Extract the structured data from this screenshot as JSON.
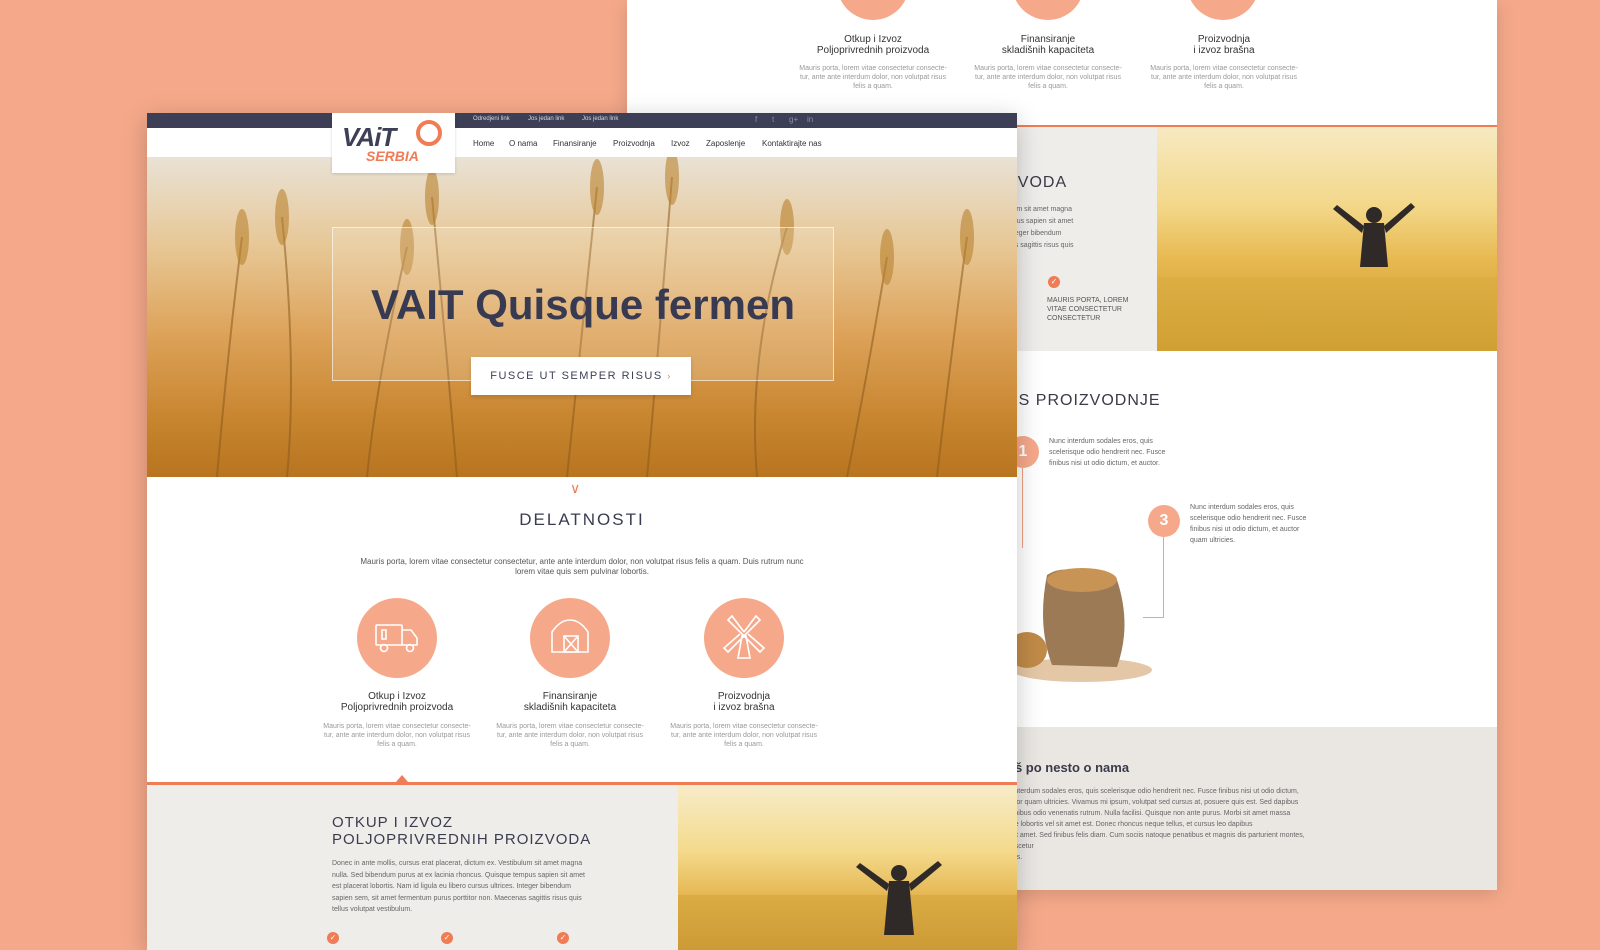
{
  "colors": {
    "background": "#f5a98a",
    "accent": "#ef7c54",
    "navy": "#3d3f56",
    "circle": "#f6a88b"
  },
  "back": {
    "services": [
      {
        "title1": "Otkup i Izvoz",
        "title2": "Poljoprivrednih proizvoda",
        "desc1": "Mauris porta, lorem vitae consectetur consecte-",
        "desc2": "tur, ante ante interdum dolor, non volutpat risus",
        "desc3": "felis a quam."
      },
      {
        "title1": "Finansiranje",
        "title2": "skladišnih kapaciteta",
        "desc1": "Mauris porta, lorem vitae consectetur consecte-",
        "desc2": "tur, ante ante interdum dolor, non volutpat risus",
        "desc3": "felis a quam."
      },
      {
        "title1": "Proizvodnja",
        "title2": "i izvoz brašna",
        "desc1": "Mauris porta, lorem vitae consectetur consecte-",
        "desc2": "tur, ante ante interdum dolor, non volutpat risus",
        "desc3": "felis a quam."
      }
    ],
    "section_a": {
      "title": "ZVODA",
      "lines": [
        "ulum sit amet magna",
        "mpus sapien sit amet",
        "Integer bibendum",
        "nas sagittis risus quis"
      ],
      "check_caption1": "MAURIS PORTA, LOREM",
      "check_caption2": "VITAE CONSECTETUR",
      "check_caption3": "CONSECTETUR"
    },
    "section_b": {
      "title": "ES PROIZVODNJE",
      "step1_num": "1",
      "step1_text1": "Nunc interdum sodales eros, quis",
      "step1_text2": "scelerisque odio hendrerit nec. Fusce",
      "step1_text3": "finibus nisi ut odio dictum, et auctor.",
      "step3_num": "3",
      "step3_text1": "Nunc interdum sodales eros, quis",
      "step3_text2": "scelerisque odio hendrerit nec. Fusce",
      "step3_text3": "finibus nisi ut odio dictum, et auctor",
      "step3_text4": "quam ultricies."
    },
    "section_c": {
      "title": "oš po nesto o nama",
      "lines": [
        "e interdum sodales eros, quis scelerisque odio hendrerit nec. Fusce finibus nisi ut odio dictum,",
        "uctor quam ultricies. Vivamus mi ipsum, volutpat sed cursus at, posuere quis est. Sed dapibus",
        "t finibus odio venenatis rutrum. Nulla facilisi. Quisque non ante purus. Morbi sit amet massa",
        "ene lobortis vel sit amet est. Donec rhoncus neque tellus, et cursus leo dapibus",
        "t sit amet. Sed finibus felis diam. Cum sociis natoque penatibus et magnis dis parturient montes, nascetur",
        "mus."
      ]
    }
  },
  "front": {
    "toplinks": [
      "Odredjeni link",
      "Jos jedan link",
      "Jos jedan link"
    ],
    "social": [
      "f",
      "t",
      "g+",
      "in"
    ],
    "logo": {
      "line1": "VAiT",
      "line2": "SERBIA"
    },
    "nav": [
      "Home",
      "O nama",
      "Finansiranje",
      "Proizvodnja",
      "Izvoz",
      "Zaposlenje",
      "Kontaktirajte nas"
    ],
    "hero": {
      "title": "VAIT Quisque fermen",
      "button": "FUSCE UT SEMPER RISUS",
      "arrow": "›"
    },
    "chevron": "∨",
    "section": {
      "title": "DELATNOSTI",
      "text1": "Mauris porta, lorem vitae consectetur consectetur, ante ante interdum dolor, non volutpat risus felis a quam. Duis rutrum nunc",
      "text2": "lorem vitae quis sem pulvinar lobortis."
    },
    "services": [
      {
        "title1": "Otkup i Izvoz",
        "title2": "Poljoprivrednih proizvoda",
        "desc1": "Mauris porta, lorem vitae consectetur consecte-",
        "desc2": "tur, ante ante interdum dolor, non volutpat risus",
        "desc3": "felis a quam."
      },
      {
        "title1": "Finansiranje",
        "title2": "skladišnih kapaciteta",
        "desc1": "Mauris porta, lorem vitae consectetur consecte-",
        "desc2": "tur, ante ante interdum dolor, non volutpat risus",
        "desc3": "felis a quam."
      },
      {
        "title1": "Proizvodnja",
        "title2": "i izvoz brašna",
        "desc1": "Mauris porta, lorem vitae consectetur consecte-",
        "desc2": "tur, ante ante interdum dolor, non volutpat risus",
        "desc3": "felis a quam."
      }
    ],
    "bottom": {
      "title1": "OTKUP I IZVOZ",
      "title2": "POLJOPRIVREDNIH PROIZVODA",
      "lines": [
        "Donec in ante mollis, cursus erat placerat, dictum ex. Vestibulum sit amet magna",
        "nulla. Sed bibendum purus at ex lacinia rhoncus. Quisque tempus sapien sit amet",
        "est placerat lobortis. Nam id ligula eu libero cursus ultrices. Integer bibendum",
        "sapien sem, sit amet fermentum purus porttitor non. Maecenas sagittis risus quis",
        "tellus volutpat vestibulum."
      ],
      "check": "✓"
    }
  }
}
